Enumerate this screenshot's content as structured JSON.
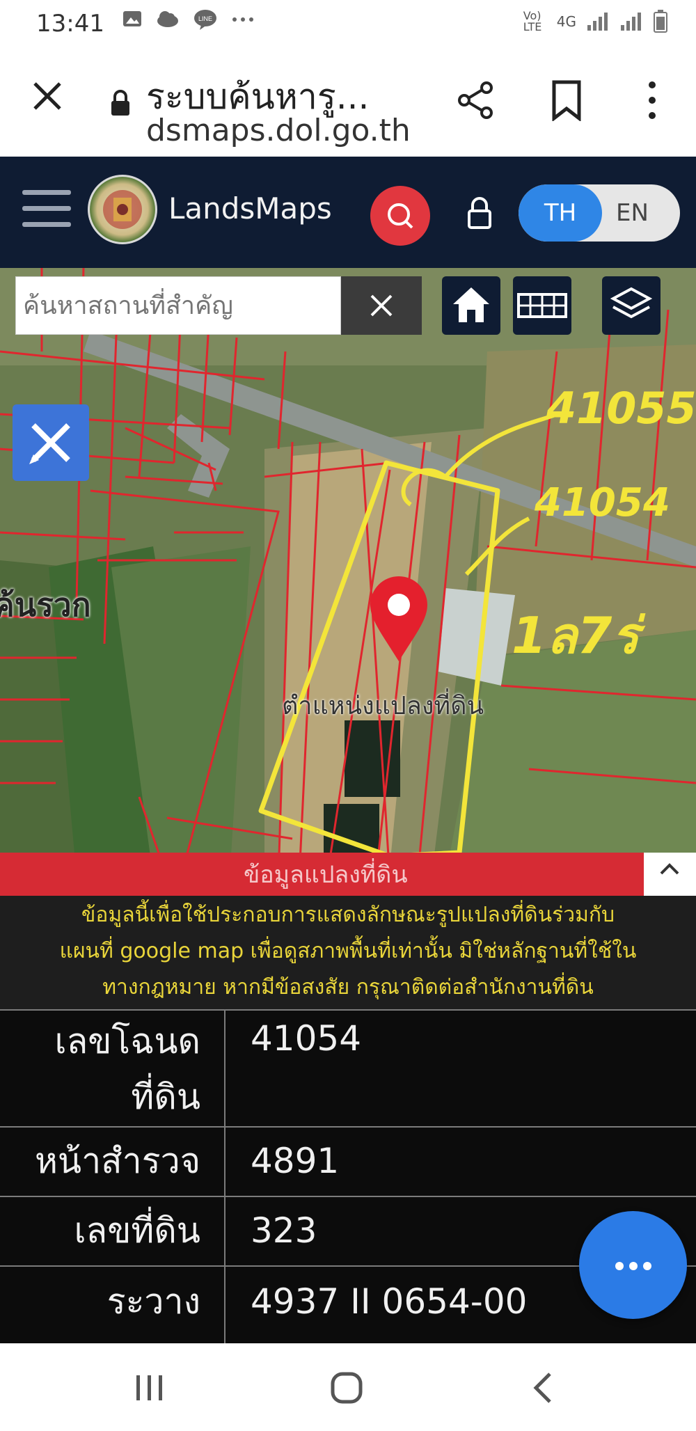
{
  "status_bar": {
    "time": "13:41",
    "icons": [
      "gallery-icon",
      "cloud-icon",
      "line-icon",
      "more-icon"
    ],
    "network": "Vo) LTE",
    "network_type": "4G"
  },
  "browser": {
    "title": "ระบบค้นหารู...",
    "url": "dsmaps.dol.go.th"
  },
  "app": {
    "brand": "LandsMaps",
    "lang_th": "TH",
    "lang_en": "EN",
    "colors": {
      "header": "#0f1c33",
      "search_button": "#e1373f",
      "lang_active": "#2f86e6"
    }
  },
  "map": {
    "search_placeholder": "ค้นหาสถานที่สำคัญ",
    "district_label": "ค้นรวก",
    "pin_label": "ตำแหน่งแปลงที่ดิน",
    "handwritten": {
      "parcel_a": "41055",
      "parcel_b": "41054",
      "area": "1ล7ร่"
    }
  },
  "info": {
    "band_label": "ข้อมูลแปลงที่ดิน",
    "disclaimer_lines": [
      "ข้อมูลนี้เพื่อใช้ประกอบการแสดงลักษณะรูปแปลงที่ดินร่วมกับ",
      "แผนที่ google map เพื่อดูสภาพพื้นที่เท่านั้น มิใช่หลักฐานที่ใช้ใน",
      "ทางกฎหมาย หากมีข้อสงสัย กรุณาติดต่อสำนักงานที่ดิน"
    ],
    "rows": [
      {
        "key_line1": "เลขโฉนด",
        "key_line2": "ที่ดิน",
        "value": "41054"
      },
      {
        "key": "หน้าสำรวจ",
        "value": "4891"
      },
      {
        "key": "เลขที่ดิน",
        "value": "323"
      },
      {
        "key": "ระวาง",
        "value": "4937 II 0654-00"
      }
    ]
  }
}
